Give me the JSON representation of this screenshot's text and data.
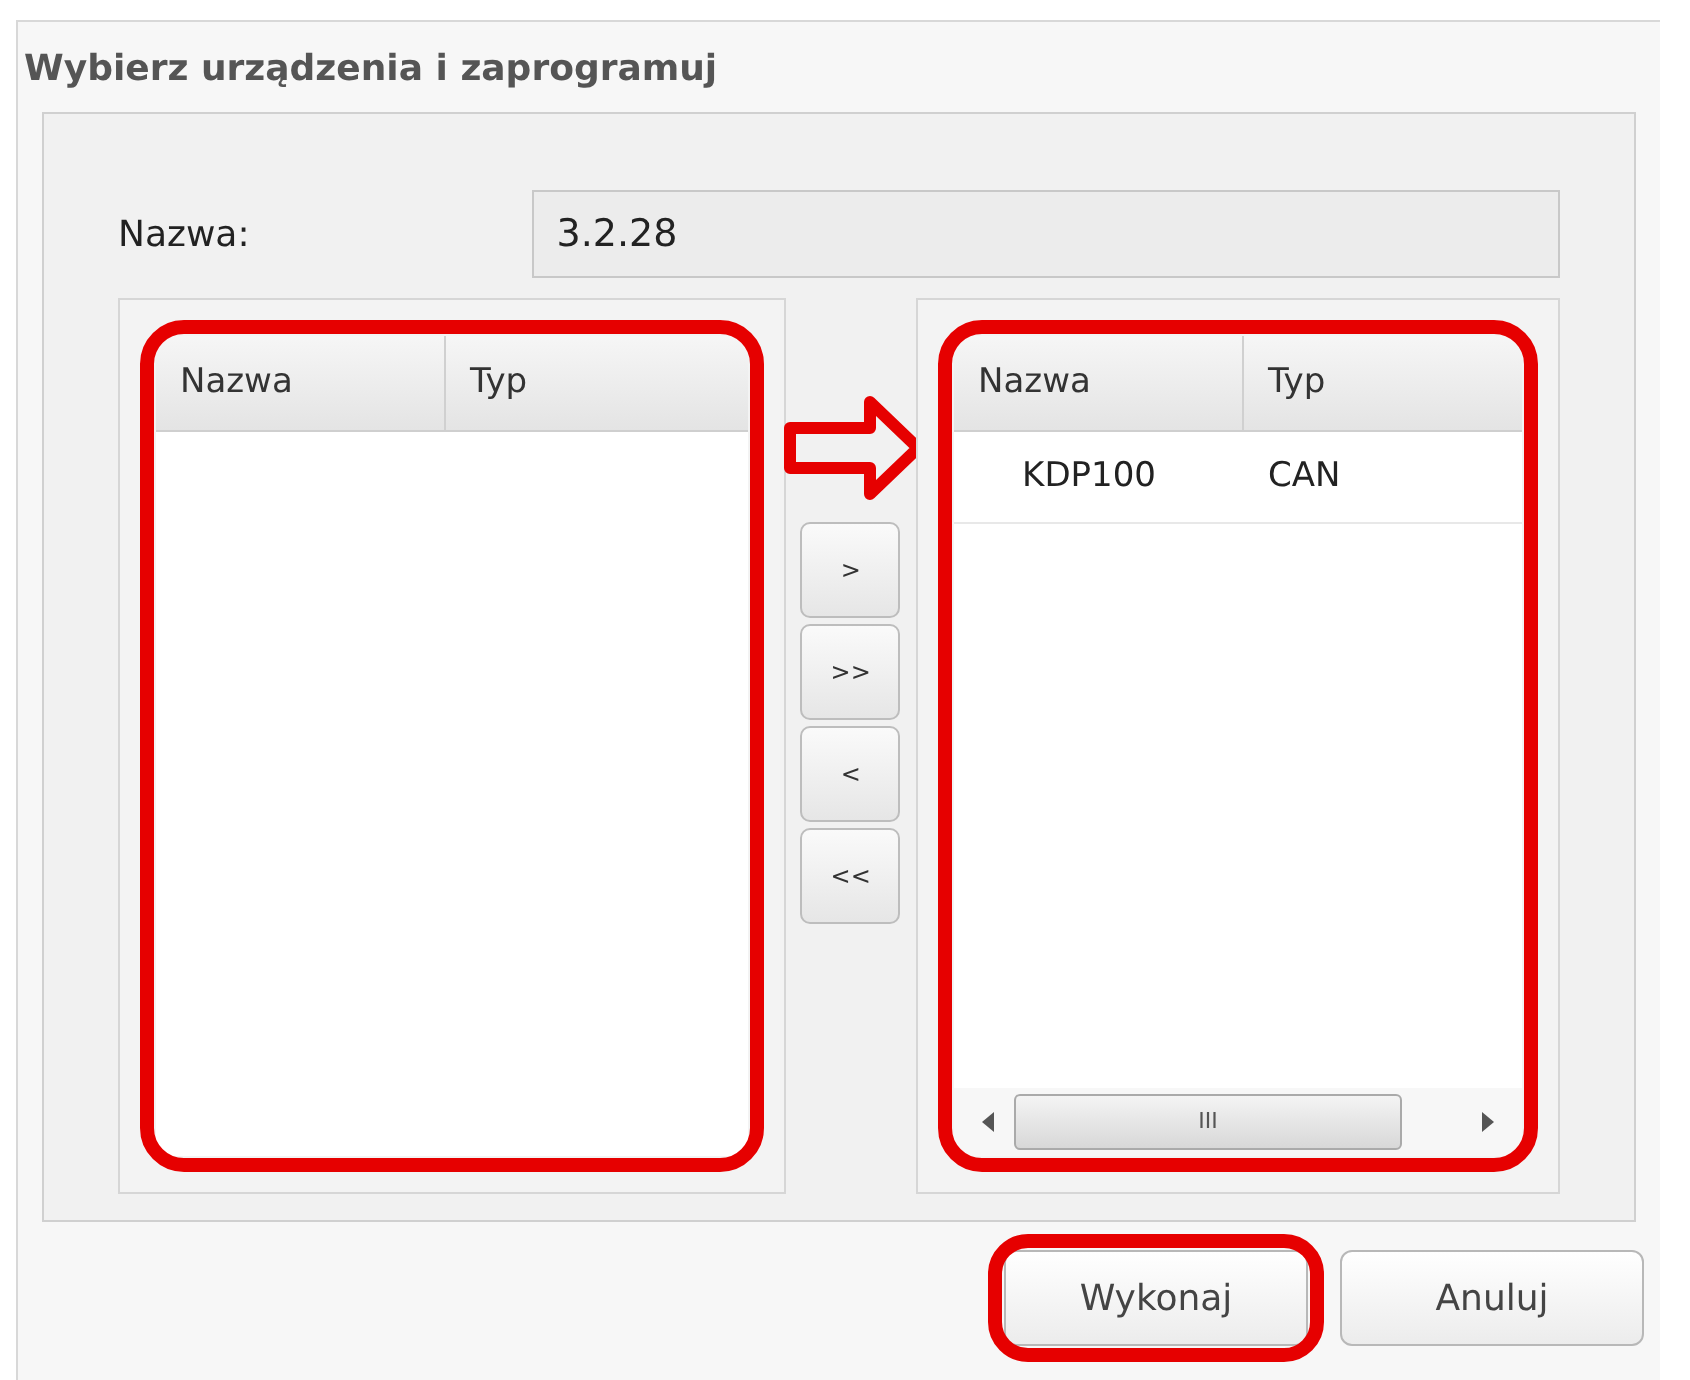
{
  "window": {
    "title": "Wybierz urządzenia i zaprogramuj"
  },
  "name_field": {
    "label": "Nazwa:",
    "value": "3.2.28"
  },
  "available_list": {
    "columns": [
      "Nazwa",
      "Typ"
    ]
  },
  "transfer_buttons": [
    ">",
    ">>",
    "<",
    "<<"
  ],
  "selected_list": {
    "columns": [
      "Nazwa",
      "Typ"
    ],
    "rows": [
      [
        "KDP100",
        "CAN"
      ]
    ]
  },
  "scrollbar_grip": "III",
  "buttons": [
    "Wykonaj",
    "Anuluj"
  ]
}
